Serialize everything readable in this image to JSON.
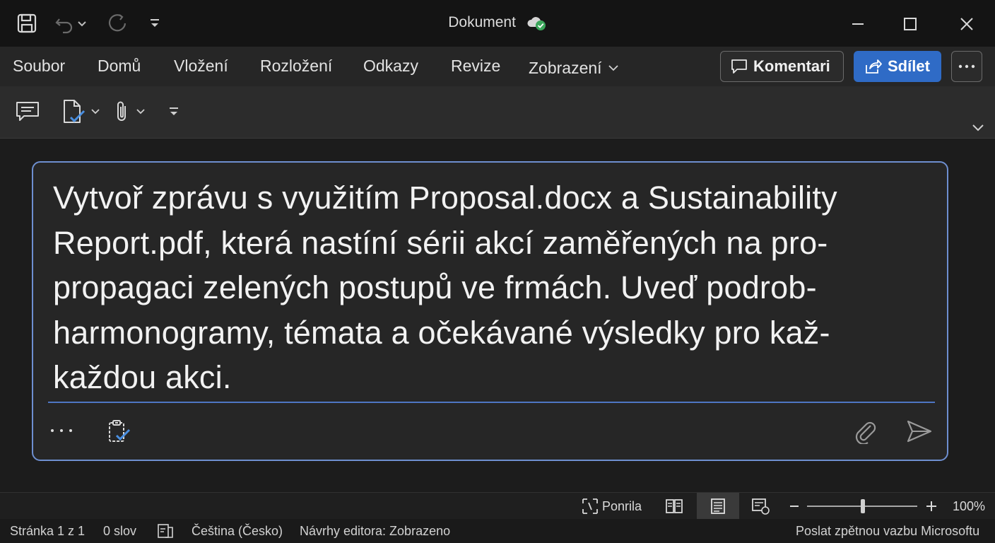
{
  "titlebar": {
    "title": "Dokument",
    "icons": [
      "save-icon",
      "undo-icon",
      "chevron-down-icon",
      "redo-icon",
      "customize-quick-access-icon",
      "cloud-saved-icon"
    ],
    "window_controls": [
      "minimize-icon",
      "maximize-icon",
      "close-icon"
    ]
  },
  "menu": {
    "items": [
      "Soubor",
      "Domů",
      "Vložení",
      "Rozložení",
      "Odkazy",
      "Revize",
      "Zobrazení"
    ],
    "komentari_label": "Komentari",
    "sdilet_label": "Sdílet",
    "more_icon": "ellipsis-icon"
  },
  "ribbon": {
    "icons": [
      "comment-icon",
      "editor-check-icon",
      "attach-icon",
      "customize-icon",
      "collapse-ribbon-icon"
    ]
  },
  "prompt": {
    "lines": [
      "Vytvoř zprávu s využitím Proposal.docx a Sustainability",
      "Report.pdf, která nastíní sérii akcí zaměřených na pro-",
      "propagaci zelených postupů ve frmách. Uveď podrob-",
      "harmonogramy, témata a očekávané výsledky pro kaž-",
      "každou akci."
    ],
    "icons": [
      "more-icon",
      "clipboard-check-icon",
      "attach-icon",
      "send-icon"
    ]
  },
  "viewbar": {
    "focus_label": "Ponrila",
    "zoom_label": "100%",
    "zoom_percent": 100,
    "icons": [
      "focus-icon",
      "read-mode-icon",
      "print-layout-icon",
      "web-layout-icon",
      "zoom-out-icon",
      "zoom-in-icon"
    ]
  },
  "statusbar": {
    "page": "Stránka 1 z 1",
    "words": "0 slov",
    "language": "Čeština (Česko)",
    "editor": "Návrhy editora: Zobrazeno",
    "feedback": "Poslat zpětnou vazbu Microsoftu"
  },
  "colors": {
    "accent": "#2f6bc6",
    "prompt_border": "#6e8fd0",
    "saved_badge": "#3aa55a"
  }
}
